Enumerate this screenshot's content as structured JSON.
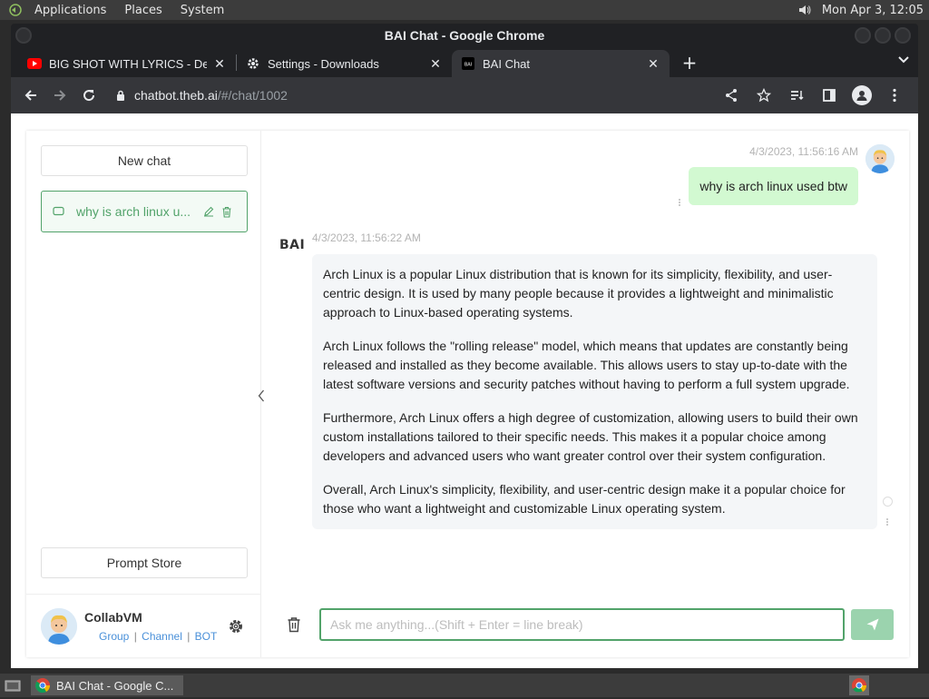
{
  "panel": {
    "applications": "Applications",
    "places": "Places",
    "system": "System",
    "clock": "Mon Apr  3, 12:05"
  },
  "window": {
    "title": "BAI Chat - Google Chrome"
  },
  "tabs": [
    {
      "title": "BIG SHOT WITH LYRICS - De",
      "favicon": "youtube-icon"
    },
    {
      "title": "Settings - Downloads",
      "favicon": "gear-icon"
    },
    {
      "title": "BAI Chat",
      "favicon": "bai-icon"
    }
  ],
  "address": {
    "host": "chatbot.theb.ai",
    "path": "/#/chat/1002"
  },
  "sidebar": {
    "new_chat": "New chat",
    "chat_item": "why is arch linux u...",
    "prompt_store": "Prompt Store",
    "user_name": "CollabVM",
    "links": [
      "Group",
      "Channel",
      "BOT"
    ]
  },
  "conversation": {
    "user_time": "4/3/2023, 11:56:16 AM",
    "user_message": "why is arch linux used btw",
    "bot_logo": "BAI",
    "bot_time": "4/3/2023, 11:56:22 AM",
    "bot_paragraphs": [
      "Arch Linux is a popular Linux distribution that is known for its simplicity, flexibility, and user-centric design. It is used by many people because it provides a lightweight and minimalistic approach to Linux-based operating systems.",
      "Arch Linux follows the \"rolling release\" model, which means that updates are constantly being released and installed as they become available. This allows users to stay up-to-date with the latest software versions and security patches without having to perform a full system upgrade.",
      "Furthermore, Arch Linux offers a high degree of customization, allowing users to build their own custom installations tailored to their specific needs. This makes it a popular choice among developers and advanced users who want greater control over their system configuration.",
      "Overall, Arch Linux's simplicity, flexibility, and user-centric design make it a popular choice for those who want a lightweight and customizable Linux operating system."
    ]
  },
  "input": {
    "placeholder": "Ask me anything...(Shift + Enter = line break)"
  },
  "taskbar": {
    "item": "BAI Chat - Google C..."
  },
  "colors": {
    "accent": "#52a36a",
    "user_bubble": "#d2f9d1",
    "bot_bubble": "#f4f6f8",
    "send_button": "#9bd3ae"
  }
}
